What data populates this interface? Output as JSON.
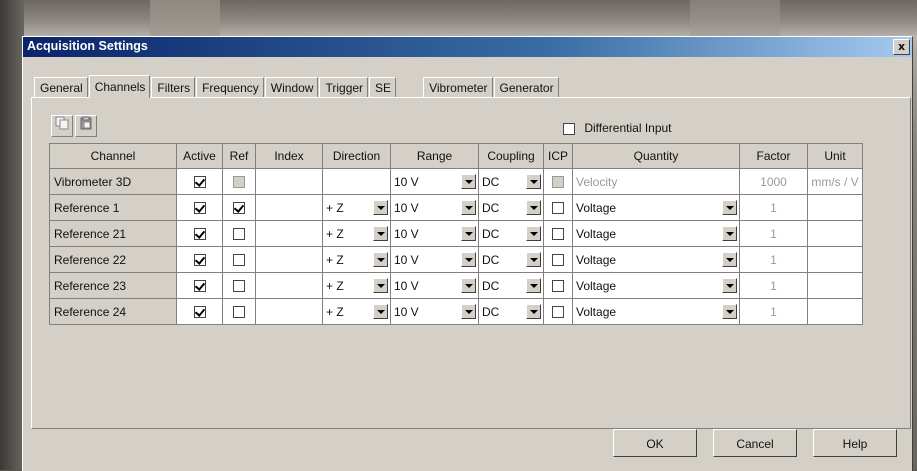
{
  "window": {
    "title": "Acquisition Settings",
    "close_label": "x"
  },
  "tabs": [
    {
      "label": "General"
    },
    {
      "label": "Channels",
      "active": true
    },
    {
      "label": "Filters"
    },
    {
      "label": "Frequency"
    },
    {
      "label": "Window"
    },
    {
      "label": "Trigger"
    },
    {
      "label": "SE"
    },
    {
      "label": "Vibrometer"
    },
    {
      "label": "Generator"
    }
  ],
  "toolbar": {
    "copy_icon": "copy-icon",
    "paste_icon": "paste-icon"
  },
  "differential_input": {
    "label": "Differential Input",
    "checked": false
  },
  "table": {
    "headers": [
      "Channel",
      "Active",
      "Ref",
      "Index",
      "Direction",
      "Range",
      "Coupling",
      "ICP",
      "Quantity",
      "Factor",
      "Unit"
    ],
    "rows": [
      {
        "channel": "Vibrometer 3D",
        "active": true,
        "ref": false,
        "ref_disabled": true,
        "index": "",
        "direction": "",
        "range": "10 V",
        "coupling": "DC",
        "icp": false,
        "icp_disabled": true,
        "quantity": "Velocity",
        "factor": "1000",
        "unit": "mm/s / V"
      },
      {
        "channel": "Reference 1",
        "active": true,
        "ref": true,
        "index": "",
        "direction": "+ Z",
        "range": "10 V",
        "coupling": "DC",
        "icp": false,
        "quantity": "Voltage",
        "factor": "1",
        "unit": ""
      },
      {
        "channel": "Reference 21",
        "active": true,
        "ref": false,
        "index": "",
        "direction": "+ Z",
        "range": "10 V",
        "coupling": "DC",
        "icp": false,
        "quantity": "Voltage",
        "factor": "1",
        "unit": ""
      },
      {
        "channel": "Reference 22",
        "active": true,
        "ref": false,
        "index": "",
        "direction": "+ Z",
        "range": "10 V",
        "coupling": "DC",
        "icp": false,
        "quantity": "Voltage",
        "factor": "1",
        "unit": ""
      },
      {
        "channel": "Reference 23",
        "active": true,
        "ref": false,
        "index": "",
        "direction": "+ Z",
        "range": "10 V",
        "coupling": "DC",
        "icp": false,
        "quantity": "Voltage",
        "factor": "1",
        "unit": ""
      },
      {
        "channel": "Reference 24",
        "active": true,
        "ref": false,
        "index": "",
        "direction": "+ Z",
        "range": "10 V",
        "coupling": "DC",
        "icp": false,
        "quantity": "Voltage",
        "factor": "1",
        "unit": ""
      }
    ]
  },
  "buttons": {
    "ok": "OK",
    "cancel": "Cancel",
    "help": "Help"
  },
  "colors": {
    "titlebar_start": "#0a246a",
    "titlebar_end": "#a6caf0",
    "dialog_bg": "#d4d0c8"
  }
}
